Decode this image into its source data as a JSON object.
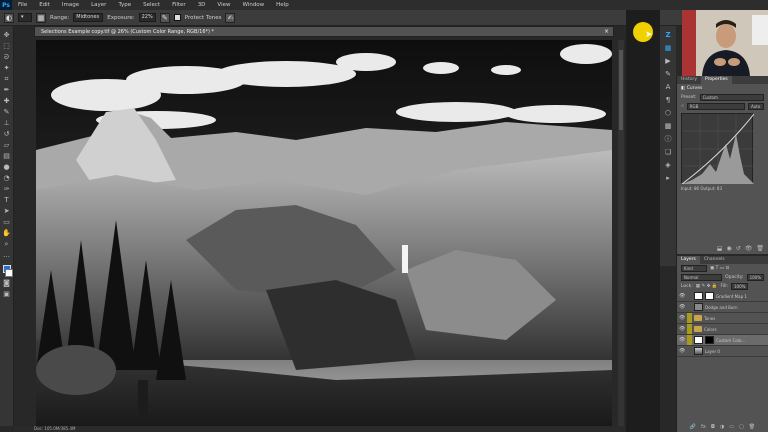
{
  "app": {
    "logo": "Ps"
  },
  "menu": [
    "File",
    "Edit",
    "Image",
    "Layer",
    "Type",
    "Select",
    "Filter",
    "3D",
    "View",
    "Window",
    "Help"
  ],
  "options": {
    "range_label": "Range:",
    "range_value": "Midtones",
    "exposure_label": "Exposure:",
    "exposure_value": "22%",
    "protect_label": "Protect Tones"
  },
  "document": {
    "title": "Selections Example copy.tif @ 26% (Custom Color Range, RGB/16*) *",
    "close": "×",
    "status": "Doc: 105.0M/385.4M"
  },
  "properties": {
    "tabs": [
      "History",
      "Properties"
    ],
    "title": "Curves",
    "preset_label": "Preset:",
    "preset_value": "Custom",
    "channel_value": "RGB",
    "auto_label": "Auto",
    "input_label": "Input:",
    "input_value": "86",
    "output_label": "Output:",
    "output_value": "83"
  },
  "layers": {
    "tabs": [
      "Layers",
      "Channels"
    ],
    "filter_value": "Kind",
    "blend_value": "Normal",
    "opacity_label": "Opacity:",
    "opacity_value": "100%",
    "lock_label": "Lock:",
    "fill_label": "Fill:",
    "fill_value": "100%",
    "items": [
      {
        "name": "Gradient Map 1"
      },
      {
        "name": "Dodge and Burn"
      },
      {
        "name": "Tones"
      },
      {
        "name": "Colors"
      },
      {
        "name": "Custom Colo..."
      },
      {
        "name": "Layer 0"
      }
    ]
  },
  "colors": {
    "accent": "#31a8ff",
    "cursor": "#f0d000",
    "folder": "#c9a44a",
    "visibility": "#a89a1e"
  }
}
